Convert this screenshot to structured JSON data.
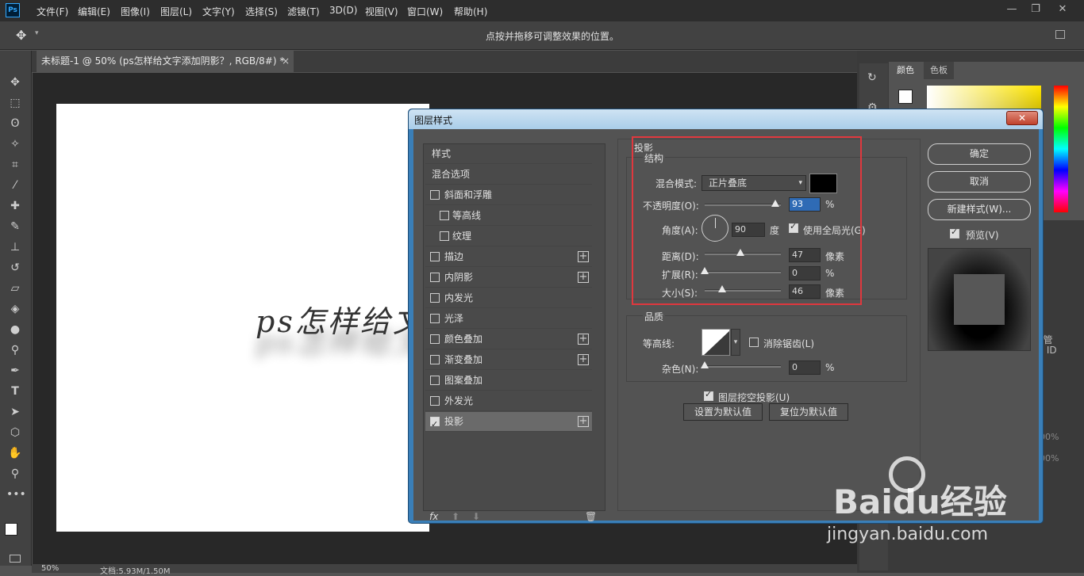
{
  "app": {
    "logo": "Ps"
  },
  "menu": [
    "文件(F)",
    "编辑(E)",
    "图像(I)",
    "图层(L)",
    "文字(Y)",
    "选择(S)",
    "滤镜(T)",
    "3D(D)",
    "视图(V)",
    "窗口(W)",
    "帮助(H)"
  ],
  "window_controls": {
    "minimize": "—",
    "restore": "❐",
    "close": "✕"
  },
  "options_bar": {
    "hint": "点按并拖移可调整效果的位置。"
  },
  "doc_tab": {
    "title": "未标题-1 @ 50% (ps怎样给文字添加阴影？, RGB/8#) *",
    "close": "×"
  },
  "canvas_text": "ps怎样给文",
  "status": {
    "zoom": "50%",
    "doc": "文档:5.93M/1.50M"
  },
  "color_panel": {
    "tabs": [
      "颜色",
      "色板"
    ]
  },
  "right_fragments": {
    "a": "IT 管",
    "b": "be ID",
    "c": "00%",
    "d": "00%"
  },
  "dialog": {
    "title": "图层样式",
    "close_label": "✕",
    "styles": [
      {
        "label": "样式",
        "check": null,
        "plus": false
      },
      {
        "label": "混合选项",
        "check": null,
        "plus": false
      },
      {
        "label": "斜面和浮雕",
        "check": false,
        "plus": false
      },
      {
        "label": "等高线",
        "check": false,
        "plus": false,
        "indent": true
      },
      {
        "label": "纹理",
        "check": false,
        "plus": false,
        "indent": true
      },
      {
        "label": "描边",
        "check": false,
        "plus": true
      },
      {
        "label": "内阴影",
        "check": false,
        "plus": true
      },
      {
        "label": "内发光",
        "check": false,
        "plus": false
      },
      {
        "label": "光泽",
        "check": false,
        "plus": false
      },
      {
        "label": "颜色叠加",
        "check": false,
        "plus": true
      },
      {
        "label": "渐变叠加",
        "check": false,
        "plus": true
      },
      {
        "label": "图案叠加",
        "check": false,
        "plus": false
      },
      {
        "label": "外发光",
        "check": false,
        "plus": false
      },
      {
        "label": "投影",
        "check": true,
        "plus": true,
        "selected": true
      }
    ],
    "list_footer": {
      "fx": "fx",
      "up": "⬆",
      "down": "⬇",
      "trash": "🗑"
    },
    "section_title": "投影",
    "structure": {
      "title": "结构",
      "blend_label": "混合模式:",
      "blend_value": "正片叠底",
      "blend_color": "#000000",
      "opacity_label": "不透明度(O):",
      "opacity_value": "93",
      "opacity_unit": "%",
      "angle_label": "角度(A):",
      "angle_value": "90",
      "angle_unit": "度",
      "global_light_label": "使用全局光(G)",
      "global_light": true,
      "distance_label": "距离(D):",
      "distance_value": "47",
      "distance_unit": "像素",
      "spread_label": "扩展(R):",
      "spread_value": "0",
      "spread_unit": "%",
      "size_label": "大小(S):",
      "size_value": "46",
      "size_unit": "像素"
    },
    "quality": {
      "title": "品质",
      "contour_label": "等高线:",
      "antialias_label": "消除锯齿(L)",
      "antialias": false,
      "noise_label": "杂色(N):",
      "noise_value": "0",
      "noise_unit": "%"
    },
    "knockout_label": "图层挖空投影(U)",
    "knockout": true,
    "set_default": "设置为默认值",
    "reset_default": "复位为默认值",
    "ok": "确定",
    "cancel": "取消",
    "new_style": "新建样式(W)...",
    "preview_label": "预览(V)",
    "preview": true
  },
  "watermark": {
    "brand": "Baidu经验",
    "url": "jingyan.baidu.com"
  }
}
